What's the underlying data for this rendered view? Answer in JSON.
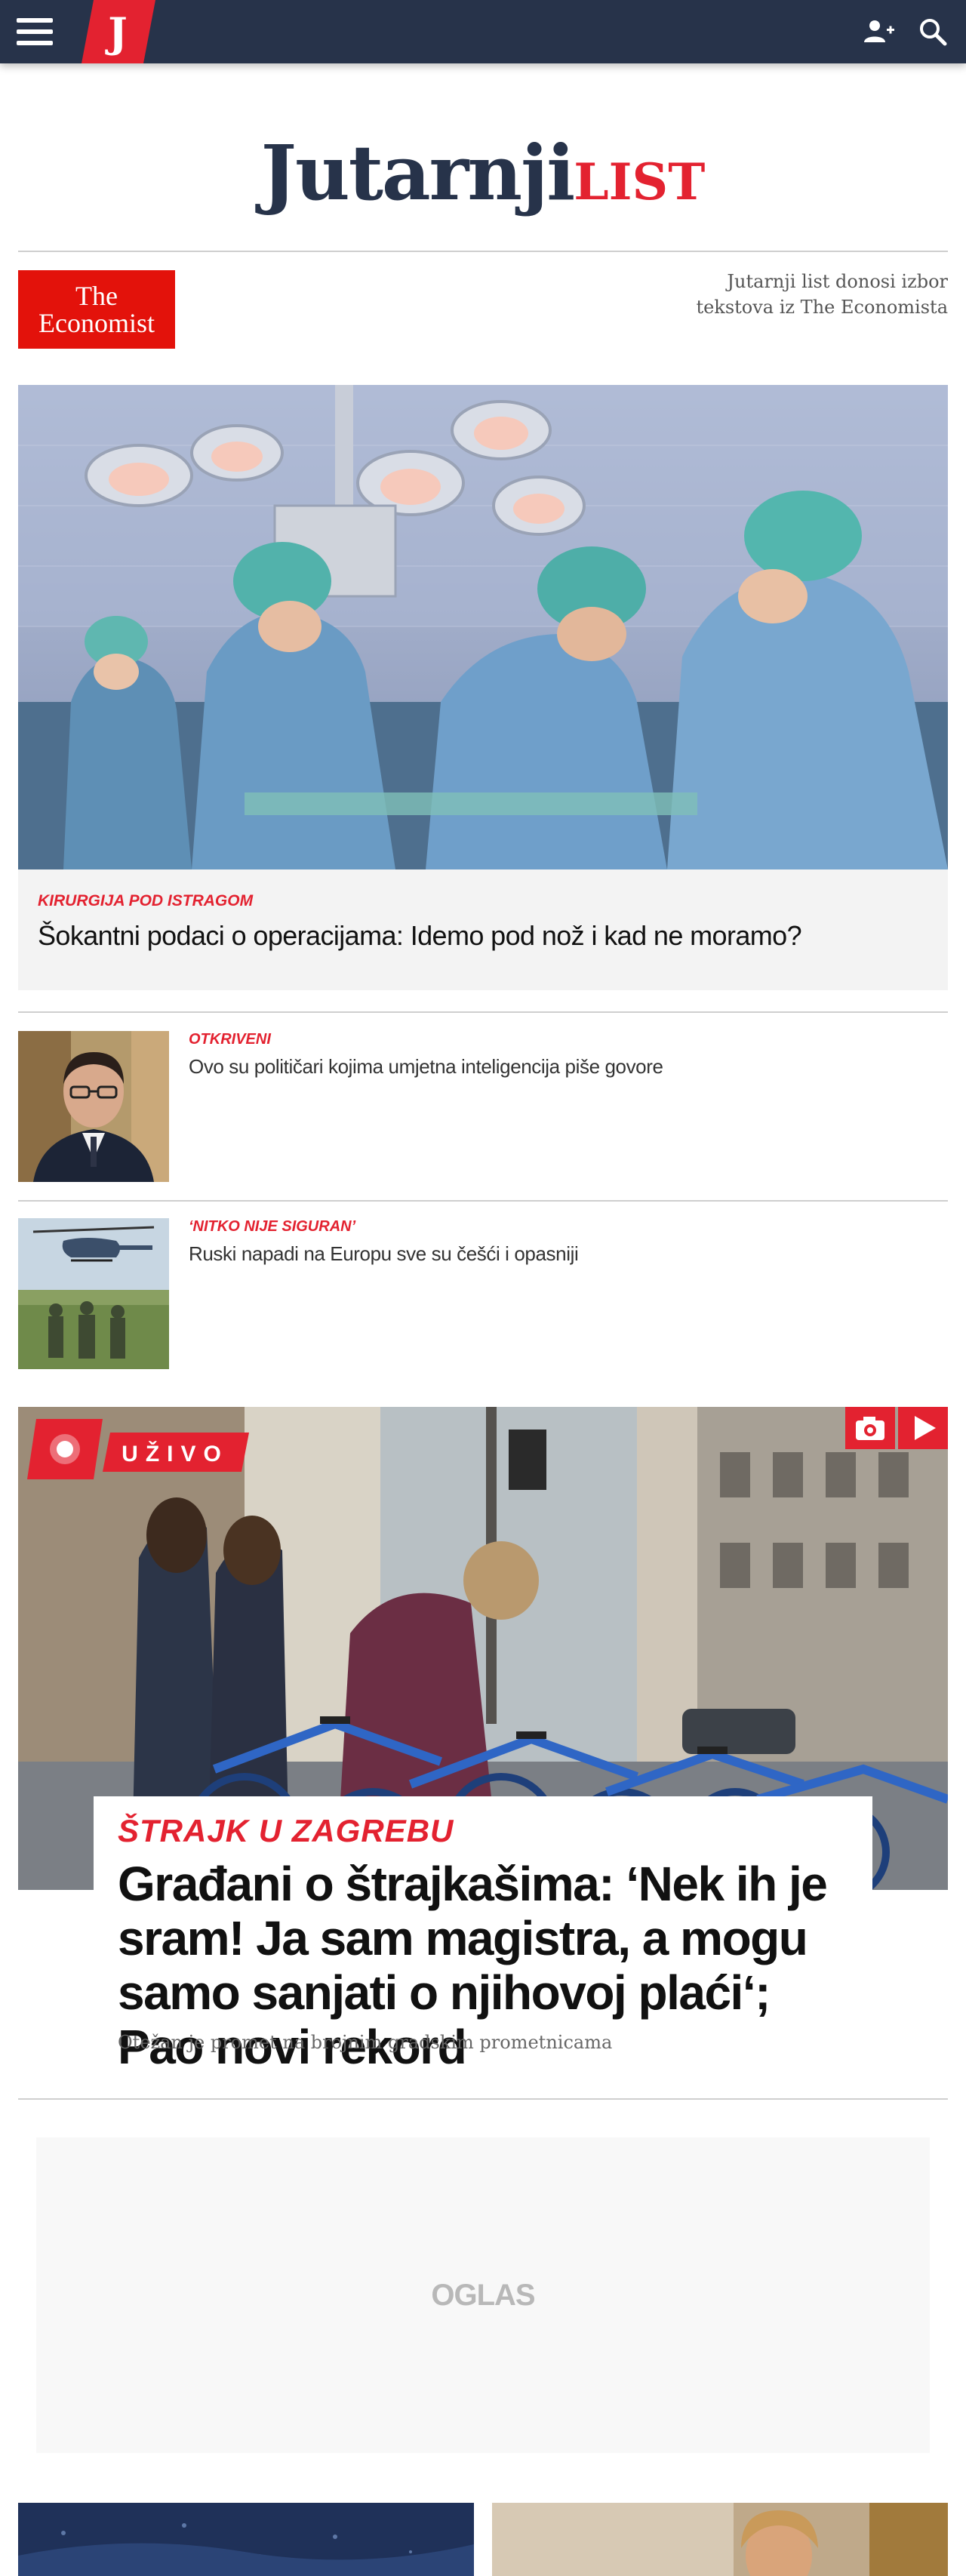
{
  "topbar": {
    "menu_icon": "hamburger-icon",
    "logo_letter": "J",
    "add_user_icon": "add-user-icon",
    "search_icon": "search-icon"
  },
  "masthead": {
    "brand_main": "Jutarnji",
    "brand_accent": "LIST"
  },
  "economist": {
    "logo_line1": "The",
    "logo_line2": "Economist",
    "note": "Jutarnji list donosi izbor tekstova iz The Economista"
  },
  "hero": {
    "kicker": "KIRURGIJA POD ISTRAGOM",
    "title": "Šokantni podaci o operacijama: Idemo pod nož i kad ne moramo?"
  },
  "list": [
    {
      "kicker": "OTKRIVENI",
      "title": "Ovo su političari kojima umjetna inteligencija piše govore"
    },
    {
      "kicker": "‘NITKO NIJE SIGURAN’",
      "title": "Ruski napadi na Europu sve su češći i opasniji"
    }
  ],
  "live": {
    "badge": "UŽIVO",
    "kicker": "ŠTRAJK U ZAGREBU",
    "title": "Građani o štrajkašima: ‘Nek ih je sram! Ja sam magistra, a mogu samo sanjati o njihovoj plaći‘; Pao novi rekord",
    "subtitle": "Otežan je promet na brojnim gradskim prometnicama",
    "icons": [
      "camera-icon",
      "play-icon"
    ]
  },
  "ad": {
    "label": "OGLAS"
  },
  "colors": {
    "navy": "#27334a",
    "red": "#e32230"
  }
}
